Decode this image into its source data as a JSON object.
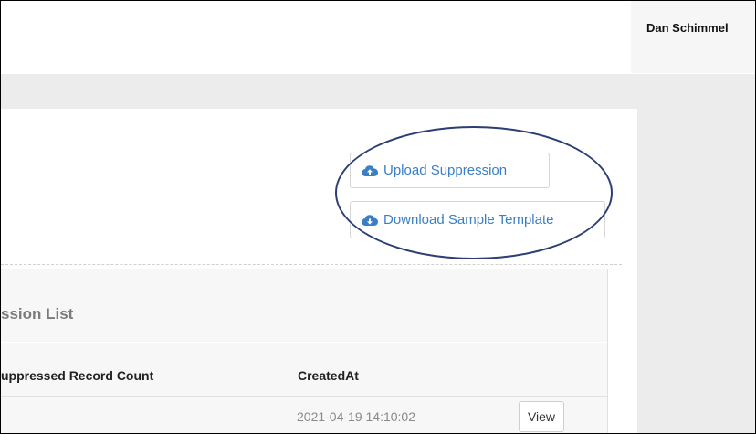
{
  "header": {
    "user_name": "Dan Schimmel"
  },
  "actions": {
    "upload_label": "Upload Suppression",
    "download_label": "Download Sample Template"
  },
  "suppression_list": {
    "title": "ssion List",
    "columns": [
      "uppressed Record Count",
      "CreatedAt"
    ],
    "rows": [
      {
        "created_at": "2021-04-19 14:10:02",
        "action_label": "View"
      }
    ]
  },
  "colors": {
    "link_blue": "#3a7fc4",
    "annotation_ellipse": "#2c3e73"
  },
  "icons": {
    "upload": "cloud-upload-icon",
    "download": "cloud-download-icon"
  }
}
